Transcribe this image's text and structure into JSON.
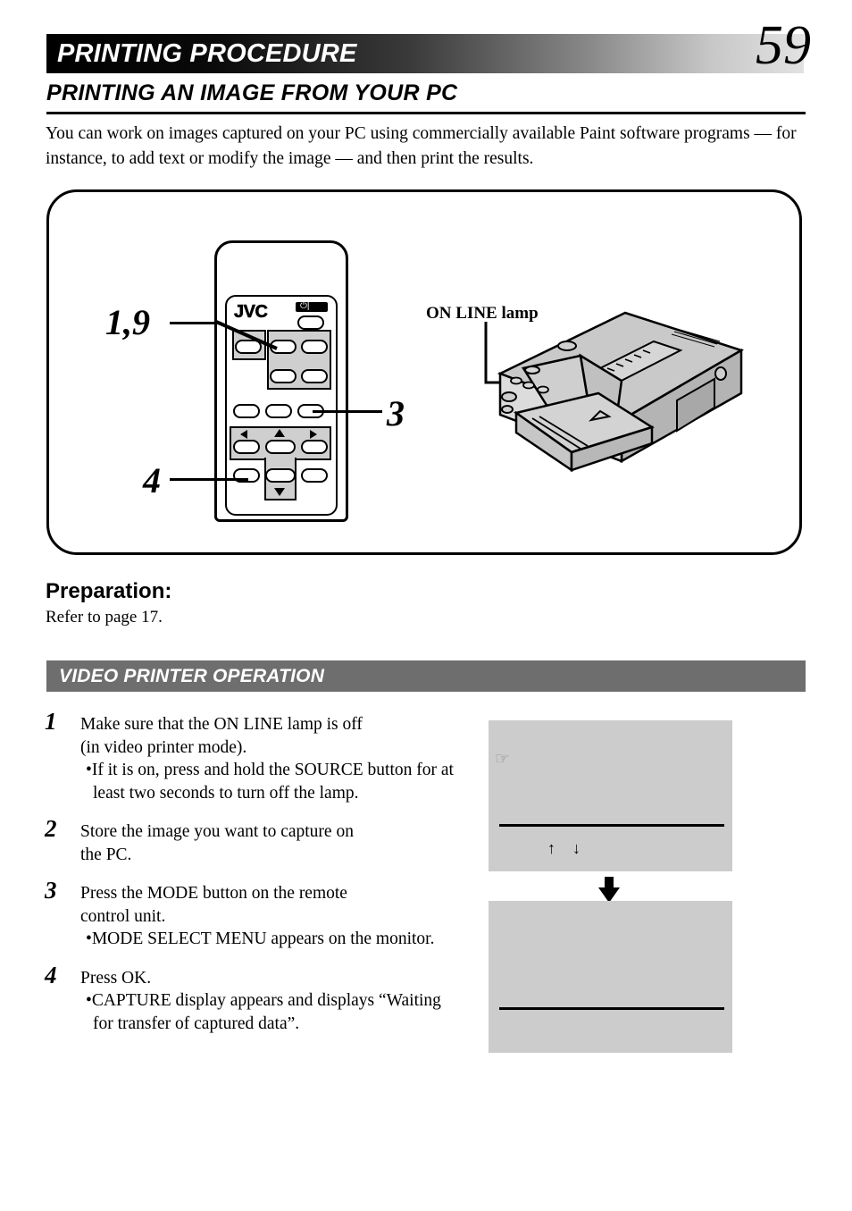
{
  "header": {
    "title": "PRINTING PROCEDURE",
    "page_number": "59"
  },
  "subtitle": "PRINTING AN IMAGE FROM YOUR PC",
  "intro": "You can work on images captured on your PC using commercially available Paint software programs — for instance, to add text or modify the image — and then print the results.",
  "illustration": {
    "remote": {
      "brand_logo": "JVC",
      "power_glyph": "⏻|",
      "callouts": [
        {
          "label": "1,9"
        },
        {
          "label": "3"
        },
        {
          "label": "4"
        }
      ]
    },
    "printer": {
      "lamp_label": "ON LINE lamp"
    }
  },
  "preparation": {
    "title": "Preparation:",
    "text": "Refer to page 17."
  },
  "section": {
    "label": "VIDEO PRINTER OPERATION"
  },
  "steps": [
    {
      "number": "1",
      "lines": [
        "Make sure that the ON LINE lamp is off",
        "(in video printer mode)."
      ],
      "bullets": [
        "•If it is on, press and hold the SOURCE button for at least two seconds to turn off the lamp."
      ]
    },
    {
      "number": "2",
      "lines": [
        "Store the image you want to capture on",
        "the PC."
      ],
      "bullets": []
    },
    {
      "number": "3",
      "lines": [
        "Press the MODE button on the remote",
        "control unit."
      ],
      "bullets": [
        "•MODE SELECT MENU appears on the monitor."
      ]
    },
    {
      "number": "4",
      "lines": [
        "Press OK."
      ],
      "bullets": [
        "•CAPTURE display appears and displays “Waiting for transfer of captured data”."
      ]
    }
  ],
  "screens": [
    {
      "name": "mode-select-menu",
      "hand_icon": "☞",
      "arrows": "↑ ↓"
    },
    {
      "name": "capture-display"
    }
  ],
  "colors": {
    "section_bar": "#6e6e6e",
    "screen_bg": "#cccccc",
    "remote_group": "#cfcfcf"
  }
}
